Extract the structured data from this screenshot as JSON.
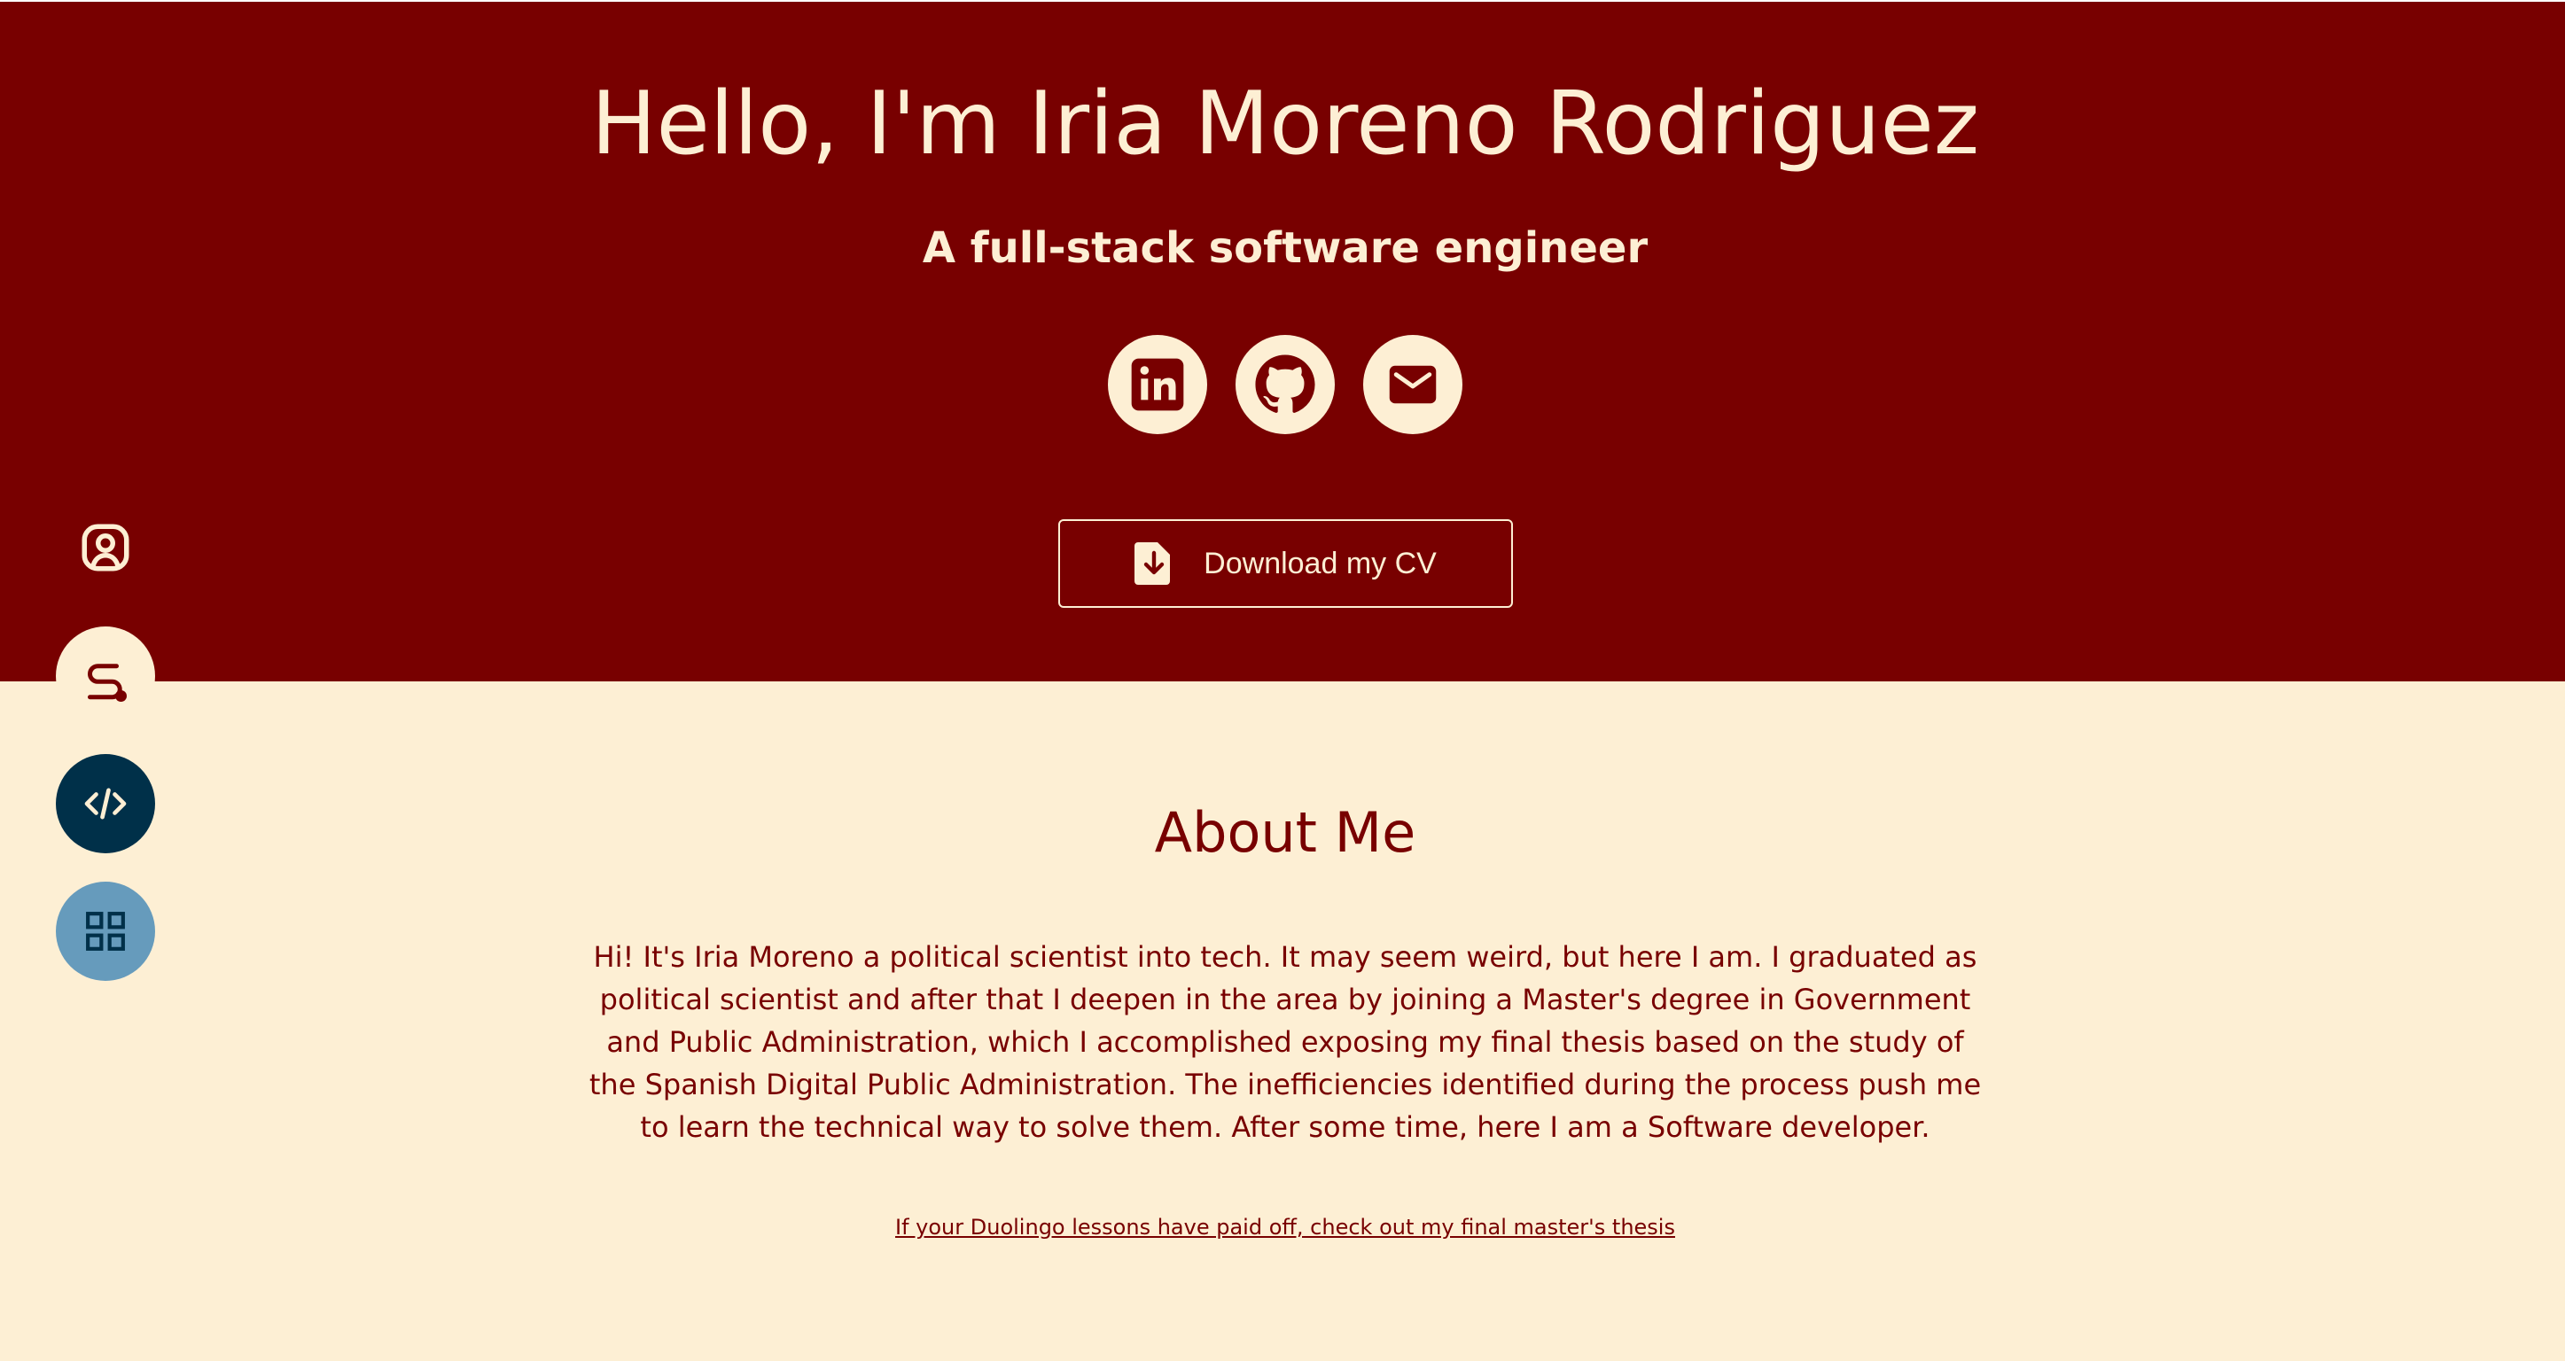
{
  "hero": {
    "title": "Hello, I'm Iria Moreno Rodriguez",
    "subtitle": "A full-stack software engineer",
    "social_links": [
      {
        "icon": "linkedin-icon"
      },
      {
        "icon": "github-icon"
      },
      {
        "icon": "mail-icon"
      }
    ],
    "cv_button_label": "Download my CV"
  },
  "side_nav": [
    {
      "icon": "user-profile-icon"
    },
    {
      "icon": "path-icon"
    },
    {
      "icon": "code-icon"
    },
    {
      "icon": "grid-icon"
    }
  ],
  "about": {
    "title": "About Me",
    "text": "Hi! It's Iria Moreno a political scientist into tech. It may seem weird, but here I am. I graduated as political scientist and after that I deepen in the area by joining a Master's degree in Government and Public Administration, which I accomplished exposing my final thesis based on the study of the Spanish Digital Public Administration. The inefficiencies identified during the process push me to learn the technical way to solve them. After some time, here I am a Software developer.",
    "thesis_link": "If your Duolingo lessons have paid off, check out my final master's thesis"
  },
  "colors": {
    "primary": "#780000",
    "cream": "#fdefd4",
    "navy": "#003049",
    "light_blue": "#669bbc"
  }
}
